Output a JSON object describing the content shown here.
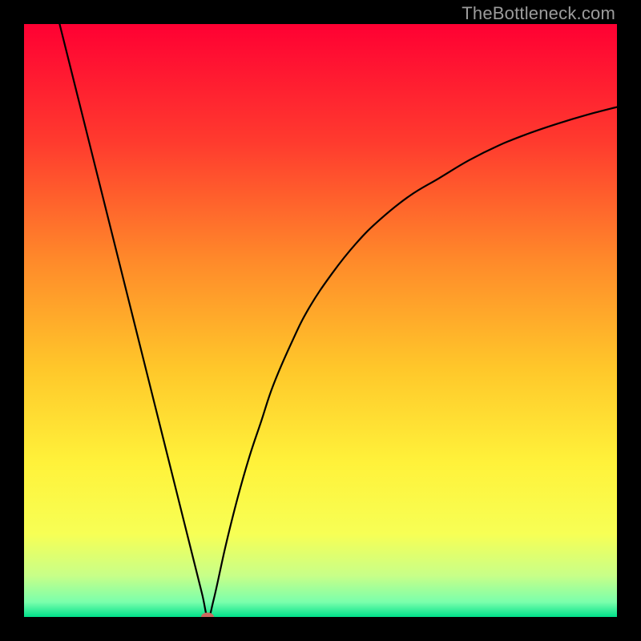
{
  "watermark": "TheBottleneck.com",
  "chart_data": {
    "type": "line",
    "title": "",
    "xlabel": "",
    "ylabel": "",
    "xlim": [
      0,
      100
    ],
    "ylim": [
      0,
      100
    ],
    "grid": false,
    "legend": false,
    "marker": {
      "x": 31,
      "y": 0,
      "color": "#cc6a5f"
    },
    "background_gradient": [
      {
        "stop": 0.0,
        "color": "#ff0033"
      },
      {
        "stop": 0.2,
        "color": "#ff3b2e"
      },
      {
        "stop": 0.4,
        "color": "#ff8a2a"
      },
      {
        "stop": 0.58,
        "color": "#ffc72a"
      },
      {
        "stop": 0.74,
        "color": "#fff23a"
      },
      {
        "stop": 0.86,
        "color": "#f7ff55"
      },
      {
        "stop": 0.93,
        "color": "#c8ff88"
      },
      {
        "stop": 0.975,
        "color": "#7affac"
      },
      {
        "stop": 1.0,
        "color": "#00e08a"
      }
    ],
    "series": [
      {
        "name": "bottleneck-curve",
        "color": "#000000",
        "x": [
          6,
          8,
          10,
          12,
          14,
          16,
          18,
          20,
          22,
          24,
          26,
          28,
          30,
          31,
          32,
          34,
          36,
          38,
          40,
          42,
          45,
          48,
          52,
          56,
          60,
          65,
          70,
          75,
          80,
          85,
          90,
          95,
          100
        ],
        "y": [
          100,
          92,
          84,
          76,
          68,
          60,
          52,
          44,
          36,
          28,
          20,
          12,
          4,
          0,
          3,
          12,
          20,
          27,
          33,
          39,
          46,
          52,
          58,
          63,
          67,
          71,
          74,
          77,
          79.5,
          81.5,
          83.2,
          84.7,
          86
        ]
      }
    ]
  }
}
